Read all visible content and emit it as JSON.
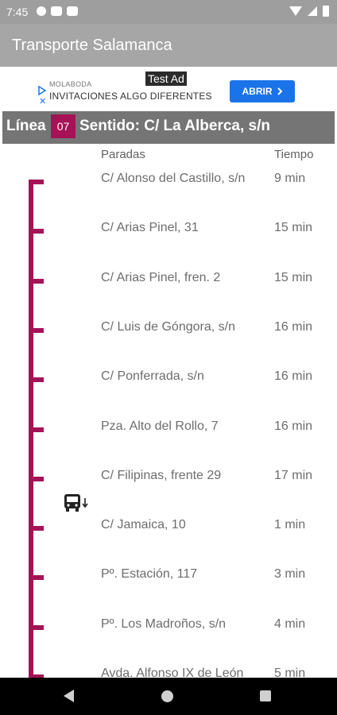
{
  "status_bar": {
    "time": "7:45"
  },
  "app_bar": {
    "title": "Transporte Salamanca"
  },
  "ad": {
    "badge": "Test Ad",
    "brand": "MOLABODA",
    "headline": "INVITACIONES ALGO DIFERENTES",
    "cta": "ABRIR",
    "close_glyph": "✕",
    "accent_color": "#1a73e8"
  },
  "line": {
    "label": "Línea",
    "number": "07",
    "direction": "Sentido: C/ La Alberca, s/n",
    "color": "#a51356"
  },
  "columns": {
    "stops": "Paradas",
    "time": "Tiempo"
  },
  "stops": [
    {
      "name": "C/ Alonso del Castillo, s/n",
      "time": "9 min"
    },
    {
      "name": "C/ Arias Pinel, 31",
      "time": "15 min"
    },
    {
      "name": "C/ Arias Pinel, fren. 2",
      "time": "15 min"
    },
    {
      "name": "C/ Luis de Góngora, s/n",
      "time": "16 min"
    },
    {
      "name": "C/ Ponferrada, s/n",
      "time": "16 min"
    },
    {
      "name": "Pza. Alto del Rollo, 7",
      "time": "16 min"
    },
    {
      "name": "C/ Filipinas, frente 29",
      "time": "17 min"
    },
    {
      "name": "C/ Jamaica, 10",
      "time": "1 min"
    },
    {
      "name": "Pº. Estación, 117",
      "time": "3 min"
    },
    {
      "name": "Pº. Los Madroños, s/n",
      "time": "4 min"
    },
    {
      "name": "Avda. Alfonso IX de León",
      "time": "5 min"
    }
  ]
}
